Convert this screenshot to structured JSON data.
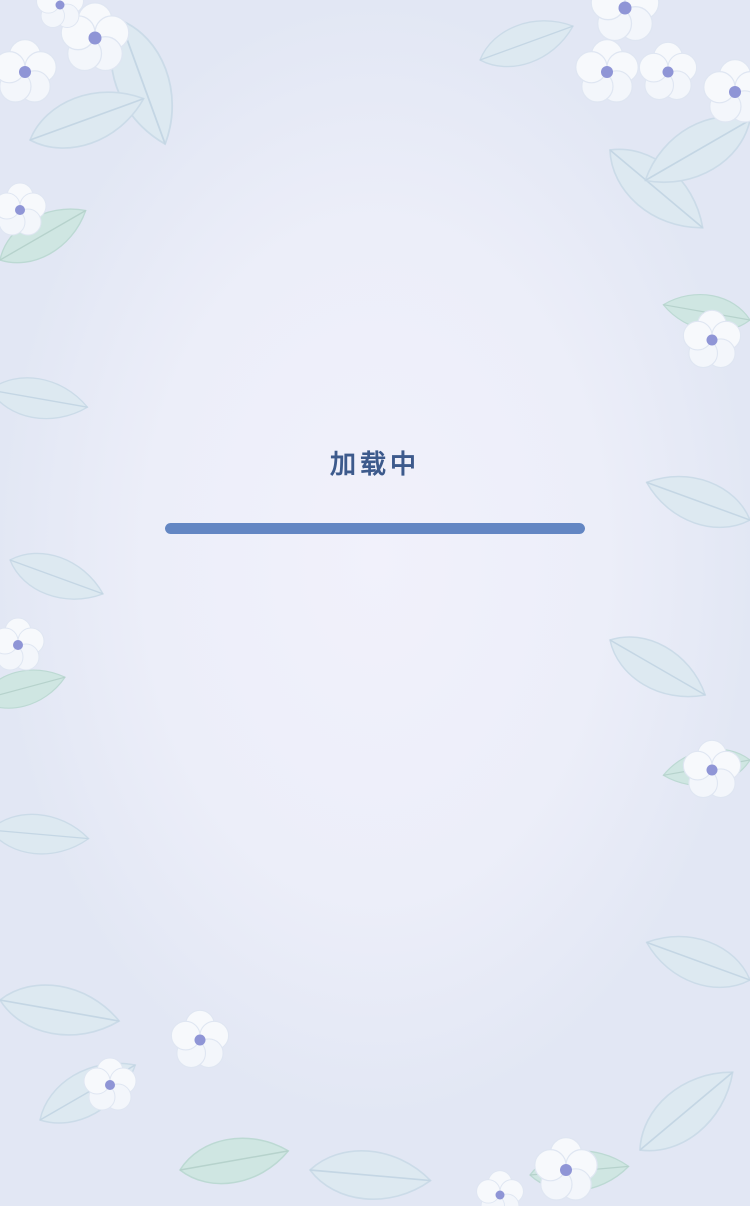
{
  "loading": {
    "label": "加载中",
    "progress_fraction": 1.0
  },
  "colors": {
    "label": "#3d5a8c",
    "progress_bar": "#6386c3",
    "background": "#eceef8",
    "flower_petal": "#f7f9fc",
    "flower_center": "#8f95d6",
    "leaf": "#d5e4ee"
  },
  "decor": {
    "theme": "pale-blue-flowers-and-leaves-border"
  }
}
